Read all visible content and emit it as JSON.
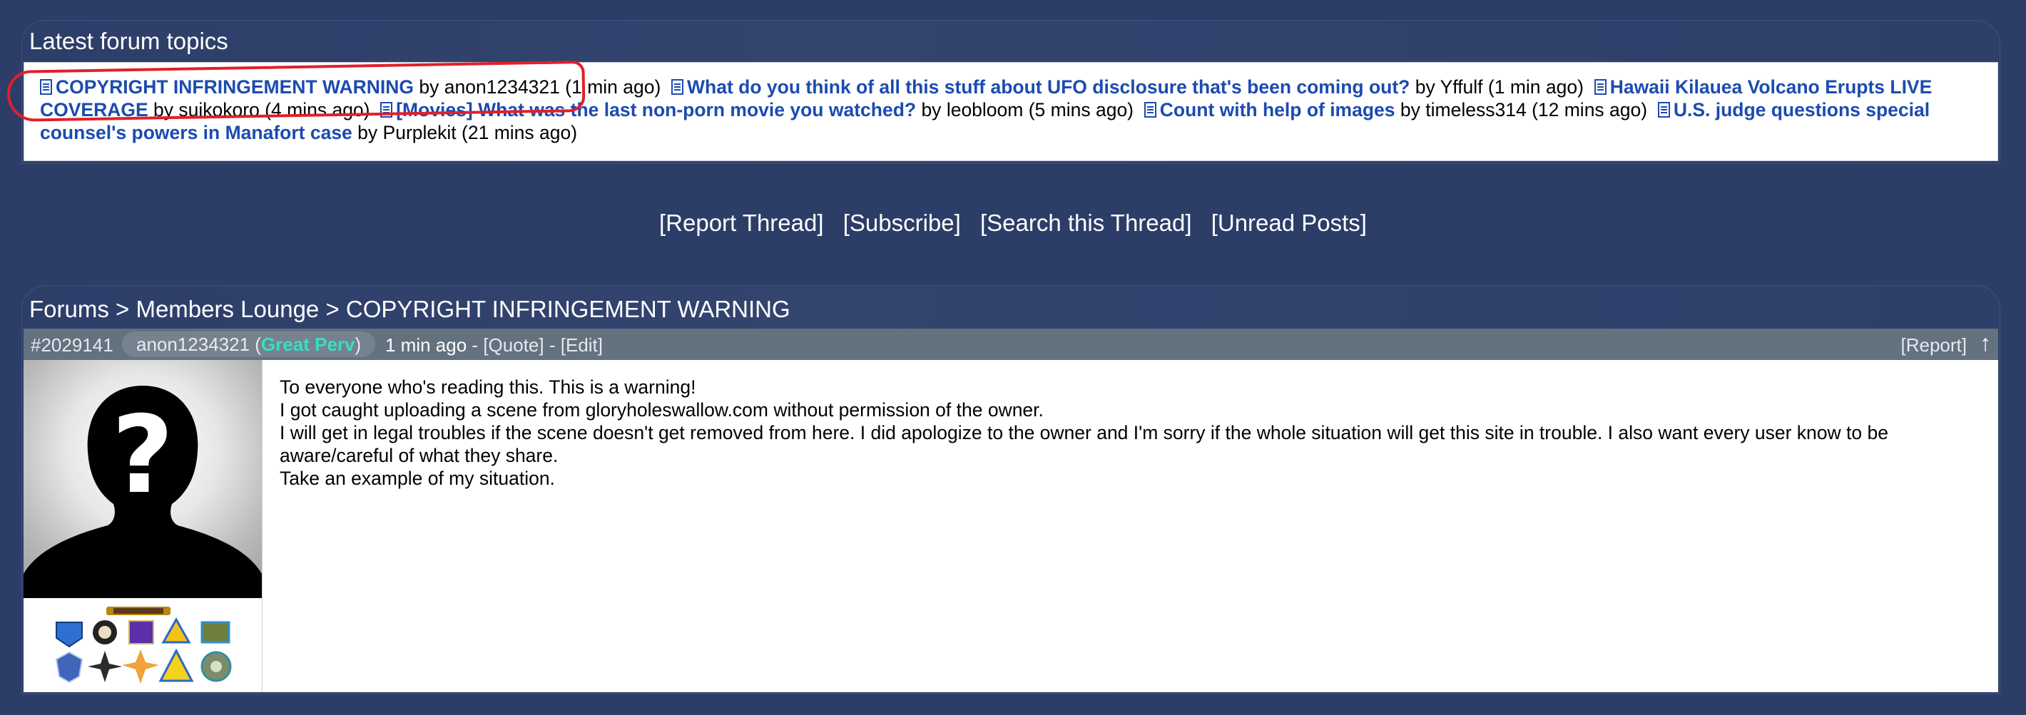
{
  "latest": {
    "title": "Latest forum topics",
    "topics": [
      {
        "title": "COPYRIGHT INFRINGEMENT WARNING",
        "by": "by",
        "author": "anon1234321",
        "time": "(1 min ago)"
      },
      {
        "title": "What do you think of all this stuff about UFO disclosure that's been coming out?",
        "by": "by",
        "author": "Yffulf",
        "time": "(1 min ago)"
      },
      {
        "title": "Hawaii Kilauea Volcano Erupts LIVE COVERAGE",
        "by": "by",
        "author": "suikokoro",
        "time": "(4 mins ago)"
      },
      {
        "title": "[Movies] What was the last non-porn movie you watched?",
        "by": "by",
        "author": "leobloom",
        "time": "(5 mins ago)"
      },
      {
        "title": "Count with help of images",
        "by": "by",
        "author": "timeless314",
        "time": "(12 mins ago)"
      },
      {
        "title": "U.S. judge questions special counsel's powers in Manafort case",
        "by": "by",
        "author": "Purplekit",
        "time": "(21 mins ago)"
      }
    ]
  },
  "thread_links": {
    "report": "[Report Thread]",
    "subscribe": "[Subscribe]",
    "search": "[Search this Thread]",
    "unread": "[Unread Posts]"
  },
  "breadcrumb": {
    "forums": "Forums",
    "sep": ">",
    "lounge": "Members Lounge",
    "thread": "COPYRIGHT INFRINGEMENT WARNING"
  },
  "post": {
    "id": "#2029141",
    "author": "anon1234321",
    "rank": "Great Perv",
    "time": "1 min ago",
    "dash": "-",
    "quote": "[Quote]",
    "edit": "[Edit]",
    "report": "[Report]",
    "up_arrow": "↑",
    "lines": [
      "To everyone who's reading this. This is a warning!",
      "I got caught uploading a scene from gloryholeswallow.com without permission of the owner.",
      "I will get in legal troubles if the scene doesn't get removed from here. I did apologize to the owner and I'm sorry if the whole situation will get this site in trouble. I also want every user know to be aware/careful of what they share.",
      "Take an example of my situation."
    ]
  },
  "colors": {
    "background": "#2c3d67",
    "link": "#1c4bb0",
    "rank": "#35e0c2",
    "annotation": "#e0202a"
  }
}
